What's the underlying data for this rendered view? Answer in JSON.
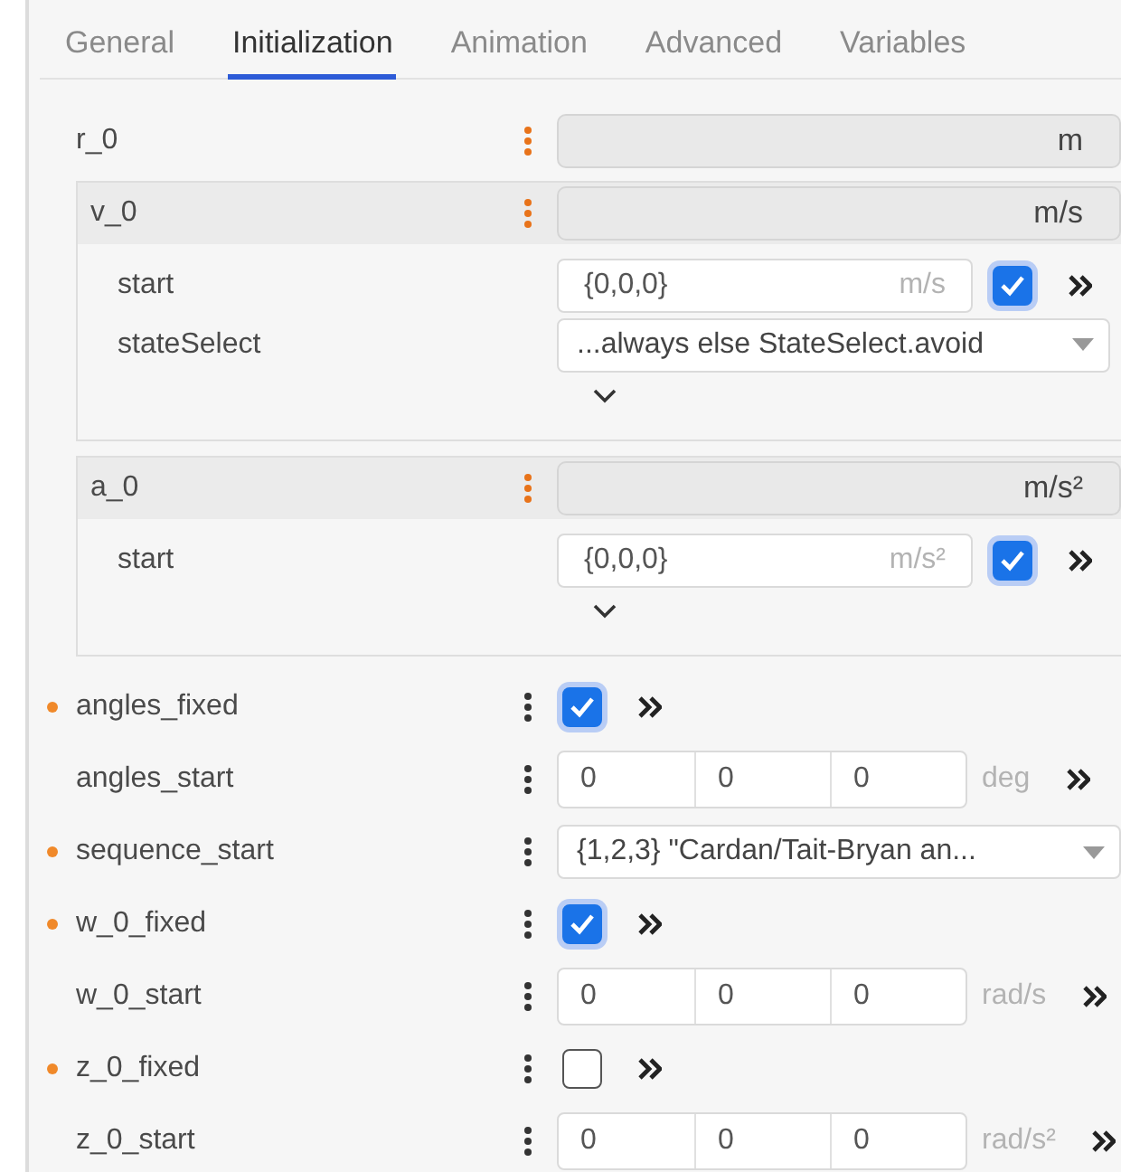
{
  "tabs": [
    {
      "label": "General",
      "selected": false
    },
    {
      "label": "Initialization",
      "selected": true
    },
    {
      "label": "Animation",
      "selected": false
    },
    {
      "label": "Advanced",
      "selected": false
    },
    {
      "label": "Variables",
      "selected": false
    }
  ],
  "groups": [
    {
      "name": "r_0",
      "unit": "m",
      "expanded": false
    },
    {
      "name": "v_0",
      "unit": "m/s",
      "expanded": true,
      "children": [
        {
          "kind": "value",
          "label": "start",
          "value": "{0,0,0}",
          "unit": "m/s",
          "checked": true
        },
        {
          "kind": "select",
          "label": "stateSelect",
          "value": "...always else StateSelect.avoid"
        }
      ]
    },
    {
      "name": "a_0",
      "unit": "m/s²",
      "expanded": true,
      "children": [
        {
          "kind": "value",
          "label": "start",
          "value": "{0,0,0}",
          "unit": "m/s²",
          "checked": true
        }
      ]
    }
  ],
  "params": [
    {
      "kind": "checkbox",
      "label": "angles_fixed",
      "modified": true,
      "checked": true
    },
    {
      "kind": "vector",
      "label": "angles_start",
      "modified": false,
      "values": [
        "0",
        "0",
        "0"
      ],
      "unit": "deg"
    },
    {
      "kind": "select",
      "label": "sequence_start",
      "modified": true,
      "value": "{1,2,3} \"Cardan/Tait-Bryan an..."
    },
    {
      "kind": "checkbox",
      "label": "w_0_fixed",
      "modified": true,
      "checked": true
    },
    {
      "kind": "vector",
      "label": "w_0_start",
      "modified": false,
      "values": [
        "0",
        "0",
        "0"
      ],
      "unit": "rad/s"
    },
    {
      "kind": "checkbox",
      "label": "z_0_fixed",
      "modified": true,
      "checked": false
    },
    {
      "kind": "vector",
      "label": "z_0_start",
      "modified": false,
      "values": [
        "0",
        "0",
        "0"
      ],
      "unit": "rad/s²"
    }
  ]
}
